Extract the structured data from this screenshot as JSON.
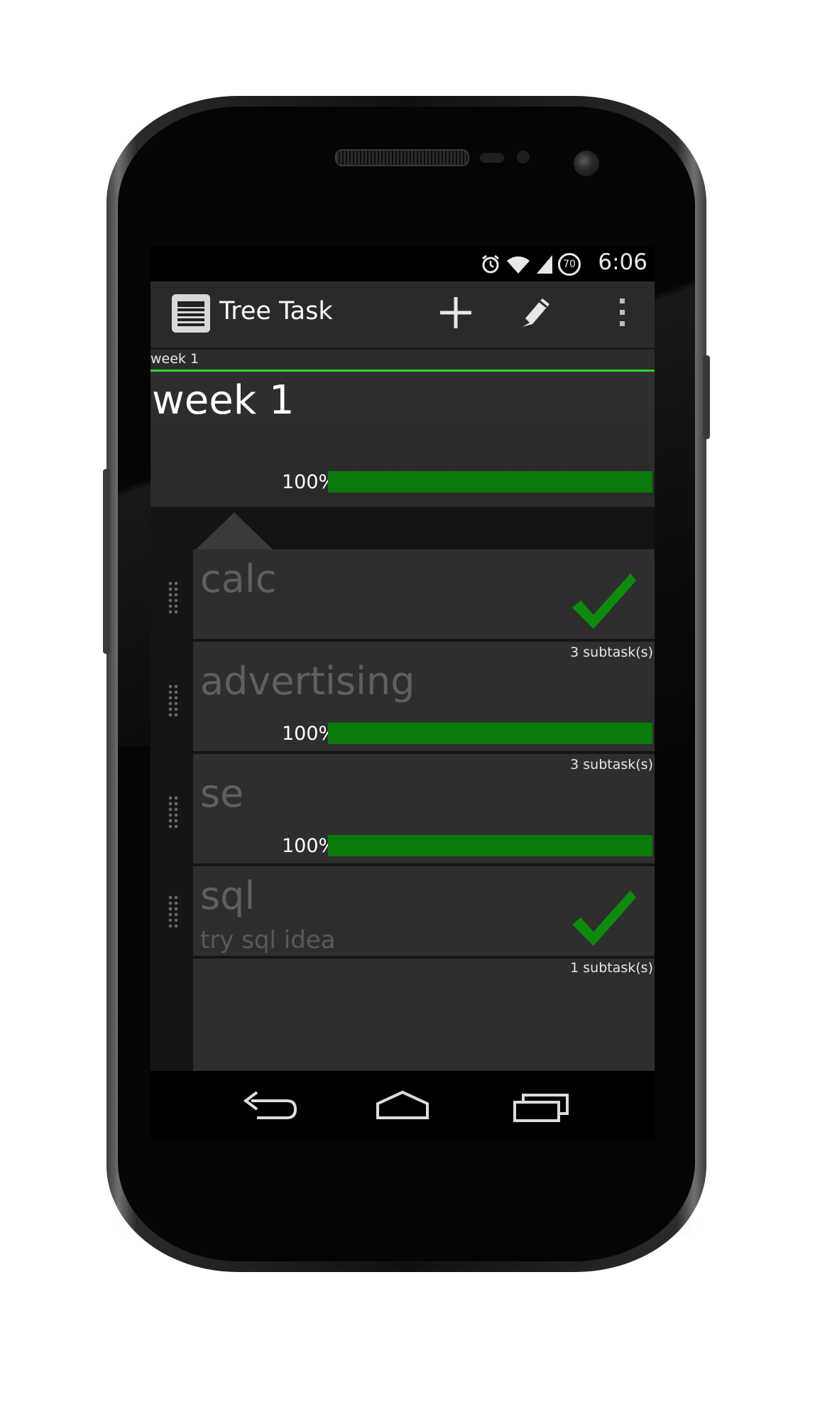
{
  "status_bar": {
    "time": "6:06",
    "battery_level": "70"
  },
  "action_bar": {
    "title": "Tree Task",
    "app_icon": "list-icon",
    "actions": [
      "plus-icon",
      "pencil-icon",
      "overflow-menu-icon"
    ]
  },
  "breadcrumb": "week 1",
  "header": {
    "title": "week 1",
    "progress_label": "100%",
    "progress": 1.0
  },
  "tasks": [
    {
      "title": "calc",
      "subtitle": "",
      "completed": true,
      "progress_label": "",
      "subtasks": ""
    },
    {
      "title": "advertising",
      "subtitle": "",
      "completed": false,
      "progress_label": "100%",
      "progress": 1.0,
      "subtasks": "3 subtask(s)"
    },
    {
      "title": "se",
      "subtitle": "",
      "completed": false,
      "progress_label": "100%",
      "progress": 1.0,
      "subtasks": "3 subtask(s)"
    },
    {
      "title": "sql",
      "subtitle": "try sql idea",
      "completed": true,
      "progress_label": "",
      "subtasks": ""
    },
    {
      "title": "",
      "subtitle": "",
      "completed": false,
      "progress_label": "",
      "subtasks": "1 subtask(s)"
    }
  ],
  "nav_bar": [
    "back-icon",
    "home-icon",
    "recent-apps-icon"
  ],
  "colors": {
    "accent": "#2fd12f",
    "progress": "#0a7a0a",
    "check": "#0e8a0e"
  }
}
